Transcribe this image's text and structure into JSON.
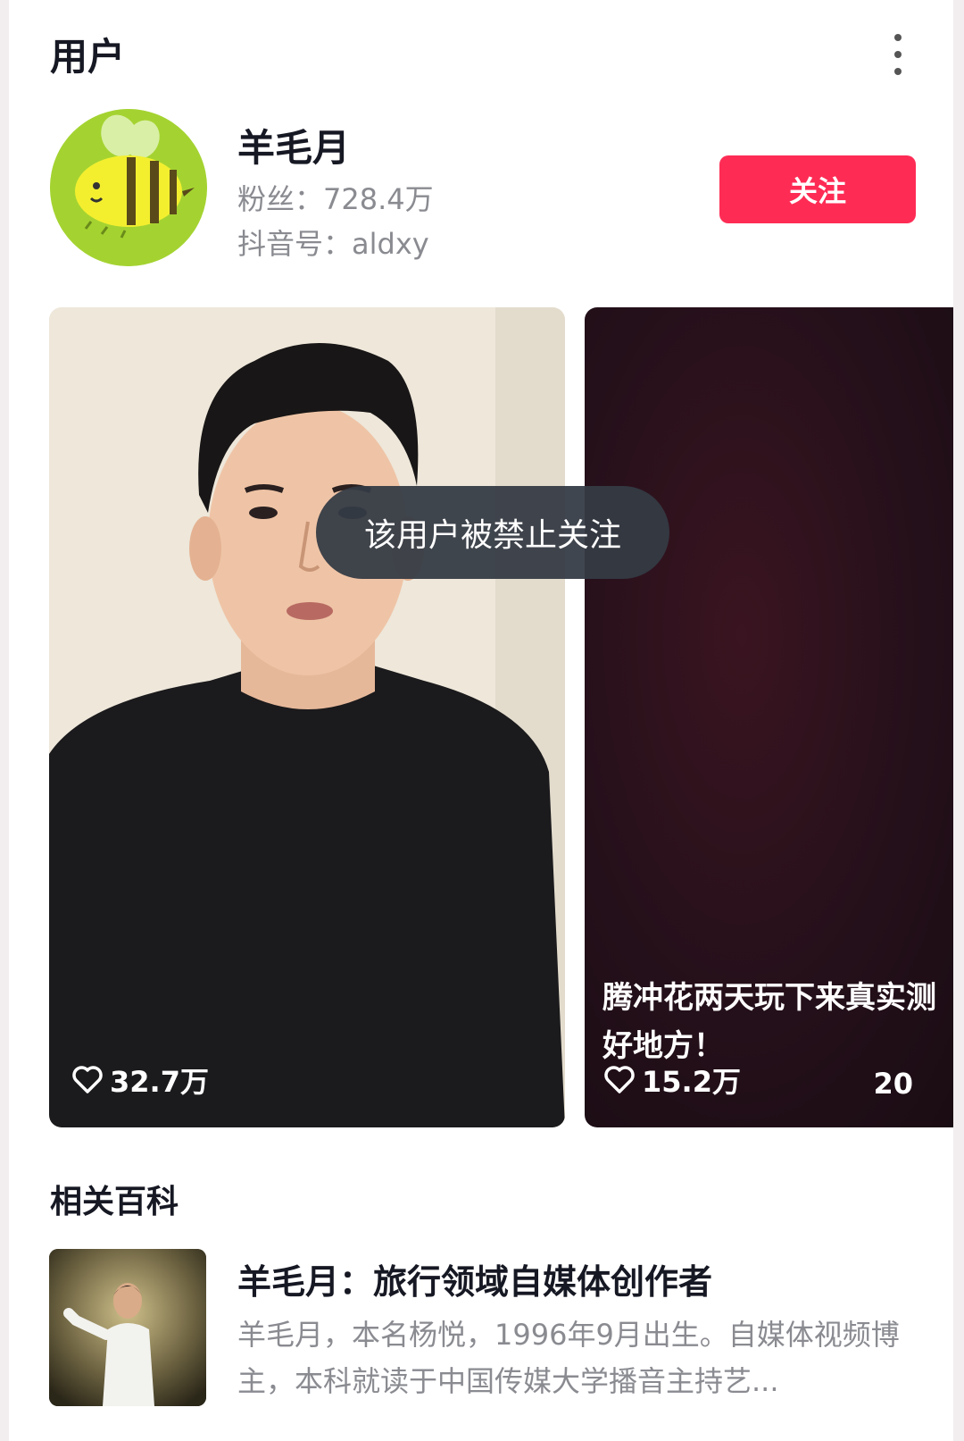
{
  "header": {
    "section_title": "用户"
  },
  "user": {
    "name": "羊毛月",
    "fans_label": "粉丝：",
    "fans_value": "728.4万",
    "id_label": "抖音号：",
    "id_value": "aldxy",
    "follow_label": "关注"
  },
  "videos": [
    {
      "likes": "32.7万",
      "caption": ""
    },
    {
      "likes": "15.2万",
      "caption_line1": "腾冲花两天玩下来真实测",
      "caption_line2": "好地方！",
      "date_fragment": "20"
    }
  ],
  "toast": {
    "message": "该用户被禁止关注"
  },
  "wiki": {
    "section_title": "相关百科",
    "headline": "羊毛月：旅行领域自媒体创作者",
    "description": "羊毛月，本名杨悦，1996年9月出生。自媒体视频博主，本科就读于中国传媒大学播音主持艺..."
  },
  "colors": {
    "follow_button": "#fe2c55",
    "toast_bg": "#343a44",
    "secondary_text": "#8a8b91",
    "avatar_bg": "#a4d331"
  }
}
